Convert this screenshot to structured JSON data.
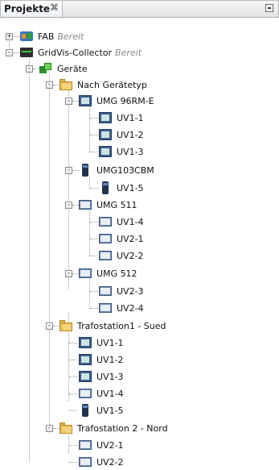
{
  "panel": {
    "title": "Projekte",
    "close_glyph": "⌘",
    "minimize_icon": "minimize-icon"
  },
  "tree": {
    "nodes": [
      {
        "label": "FAB",
        "status": "Bereit",
        "icon": "project-icon",
        "expander": "+"
      },
      {
        "label": "GridVis-Collector",
        "status": "Bereit",
        "icon": "collector-icon",
        "expander": "-"
      },
      {
        "label": "Geräte",
        "icon": "devices-icon",
        "expander": "-"
      },
      {
        "label": "Nach Gerätetyp",
        "icon": "folder-icon",
        "expander": "-"
      },
      {
        "label": "UMG 96RM-E",
        "icon": "umg96-icon",
        "expander": "-"
      },
      {
        "label": "UV1-1",
        "icon": "umg96-icon"
      },
      {
        "label": "UV1-2",
        "icon": "umg96-icon"
      },
      {
        "label": "UV1-3",
        "icon": "umg96-icon"
      },
      {
        "label": "UMG103CBM",
        "icon": "umg103-icon",
        "expander": "-"
      },
      {
        "label": "UV1-5",
        "icon": "umg103-icon"
      },
      {
        "label": "UMG 511",
        "icon": "umg511-icon",
        "expander": "-"
      },
      {
        "label": "UV1-4",
        "icon": "umg511-icon"
      },
      {
        "label": "UV2-1",
        "icon": "umg511-icon"
      },
      {
        "label": "UV2-2",
        "icon": "umg511-icon"
      },
      {
        "label": "UMG 512",
        "icon": "umg511-icon",
        "expander": "-"
      },
      {
        "label": "UV2-3",
        "icon": "umg511-icon"
      },
      {
        "label": "UV2-4",
        "icon": "umg511-icon"
      },
      {
        "label": "Trafostation1 - Sued",
        "icon": "folder-icon",
        "expander": "-"
      },
      {
        "label": "UV1-1",
        "icon": "umg96-icon"
      },
      {
        "label": "UV1-2",
        "icon": "umg96-icon"
      },
      {
        "label": "UV1-3",
        "icon": "umg96-icon"
      },
      {
        "label": "UV1-4",
        "icon": "umg511-icon"
      },
      {
        "label": "UV1-5",
        "icon": "umg103-icon"
      },
      {
        "label": "Trafostation 2 - Nord",
        "icon": "folder-icon",
        "expander": "-"
      },
      {
        "label": "UV2-1",
        "icon": "umg511-icon"
      },
      {
        "label": "UV2-2",
        "icon": "umg511-icon"
      }
    ]
  }
}
